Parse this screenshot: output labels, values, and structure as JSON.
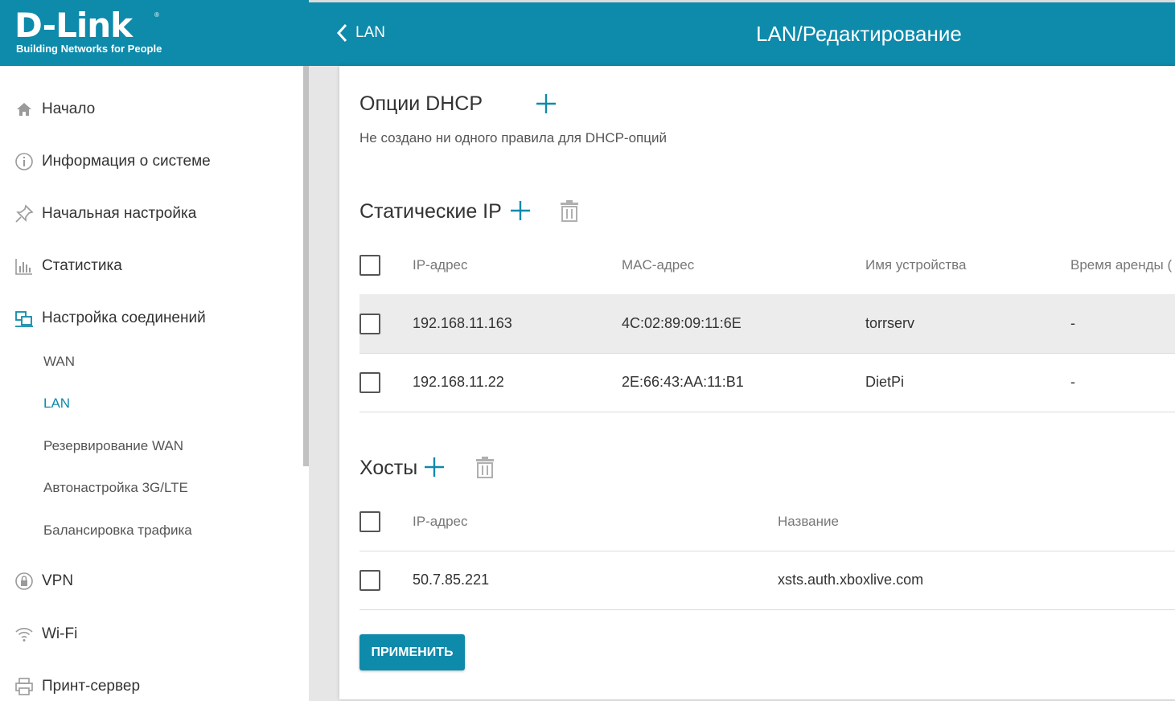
{
  "brand": {
    "name": "D-Link",
    "reg": "®",
    "tagline": "Building Networks for People"
  },
  "header": {
    "back_label": "LAN",
    "title": "LAN/Редактирование"
  },
  "sidebar": {
    "items": [
      {
        "label": "Начало",
        "icon": "home-icon"
      },
      {
        "label": "Информация о системе",
        "icon": "info-icon"
      },
      {
        "label": "Начальная настройка",
        "icon": "pin-icon"
      },
      {
        "label": "Статистика",
        "icon": "bar-chart-icon"
      },
      {
        "label": "Настройка соединений",
        "icon": "connections-icon"
      },
      {
        "label": "VPN",
        "icon": "lock-icon"
      },
      {
        "label": "Wi-Fi",
        "icon": "wifi-icon"
      },
      {
        "label": "Принт-сервер",
        "icon": "printer-icon"
      }
    ],
    "subitems": [
      {
        "label": "WAN",
        "active": false
      },
      {
        "label": "LAN",
        "active": true
      },
      {
        "label": "Резервирование WAN",
        "active": false
      },
      {
        "label": "Автонастройка 3G/LTE",
        "active": false
      },
      {
        "label": "Балансировка трафика",
        "active": false
      }
    ]
  },
  "dhcp_options": {
    "title": "Опции DHCP",
    "empty_note": "Не создано ни одного правила для DHCP-опций"
  },
  "static_ip": {
    "title": "Статические IP",
    "headers": {
      "ip": "IP-адрес",
      "mac": "MAC-адрес",
      "name": "Имя устройства",
      "lease": "Время аренды ("
    },
    "rows": [
      {
        "ip": "192.168.11.163",
        "mac": "4C:02:89:09:11:6E",
        "name": "torrserv",
        "lease": "-"
      },
      {
        "ip": "192.168.11.22",
        "mac": "2E:66:43:AA:11:B1",
        "name": "DietPi",
        "lease": "-"
      }
    ]
  },
  "hosts": {
    "title": "Хосты",
    "headers": {
      "ip": "IP-адрес",
      "name": "Название"
    },
    "rows": [
      {
        "ip": "50.7.85.221",
        "name": "xsts.auth.xboxlive.com"
      }
    ]
  },
  "apply_label": "ПРИМЕНИТЬ",
  "colors": {
    "accent": "#0e8aab",
    "row_highlight": "#ececec",
    "content_bg": "#e6e6e6"
  }
}
